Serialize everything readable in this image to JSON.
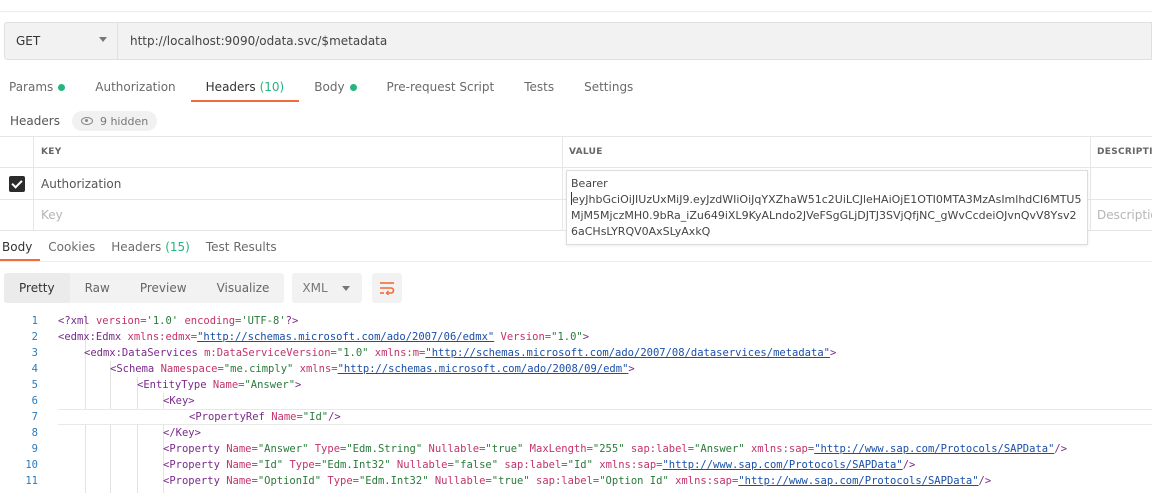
{
  "request": {
    "method": "GET",
    "url": "http://localhost:9090/odata.svc/$metadata"
  },
  "request_tabs": [
    {
      "label": "Params",
      "dot": true,
      "count": ""
    },
    {
      "label": "Authorization",
      "dot": false,
      "count": ""
    },
    {
      "label": "Headers",
      "dot": false,
      "count": "(10)"
    },
    {
      "label": "Body",
      "dot": true,
      "count": ""
    },
    {
      "label": "Pre-request Script",
      "dot": false,
      "count": ""
    },
    {
      "label": "Tests",
      "dot": false,
      "count": ""
    },
    {
      "label": "Settings",
      "dot": false,
      "count": ""
    }
  ],
  "headers_section": {
    "title": "Headers",
    "hidden_label": "9 hidden"
  },
  "table": {
    "col_key": "KEY",
    "col_value": "VALUE",
    "col_description": "DESCRIPTION",
    "row1_key": "Authorization",
    "row1_checked": true,
    "new_key_placeholder": "Key",
    "new_desc_placeholder": "Description"
  },
  "value_popup": {
    "line1": "Bearer",
    "token": "eyJhbGciOiJIUzUxMiJ9.eyJzdWIiOiJqYXZhaW51c2UiLCJleHAiOjE1OTI0MTA3MzAsImlhdCI6MTU5MjM5MjczMH0.9bRa_iZu649iXL9KyALndo2JVeFSgGLjDJTJ3SVjQfjNC_gWvCcdeiOJvnQvV8Ysv26aCHsLYRQV0AxSLyAxkQ"
  },
  "response_tabs": [
    {
      "label": "Body",
      "count": ""
    },
    {
      "label": "Cookies",
      "count": ""
    },
    {
      "label": "Headers",
      "count": "(15)"
    },
    {
      "label": "Test Results",
      "count": ""
    }
  ],
  "response_toolbar": {
    "modes": [
      "Pretty",
      "Raw",
      "Preview",
      "Visualize"
    ],
    "format": "XML"
  },
  "code_lines": [
    "1",
    "2",
    "3",
    "4",
    "5",
    "6",
    "7",
    "8",
    "9",
    "10",
    "11"
  ],
  "code": {
    "l1_a": "<?xml ",
    "l1_b": "version=",
    "l1_c": "'1.0' ",
    "l1_d": "encoding=",
    "l1_e": "'UTF-8'",
    "l1_f": "?>",
    "l2_tag": "<edmx:Edmx ",
    "l2_attr1": "xmlns:edmx=",
    "l2_url1": "\"http://schemas.microsoft.com/ado/2007/06/edmx\"",
    "l2_attr2": " Version=",
    "l2_str2": "\"1.0\"",
    "l2_end": ">",
    "l3_tag": "<edmx:DataServices ",
    "l3_attr1": "m:DataServiceVersion=",
    "l3_str1": "\"1.0\"",
    "l3_attr2": " xmlns:m=",
    "l3_url2": "\"http://schemas.microsoft.com/ado/2007/08/dataservices/metadata\"",
    "l3_end": ">",
    "l4_tag": "<Schema ",
    "l4_attr1": "Namespace=",
    "l4_str1": "\"me.cimply\"",
    "l4_attr2": " xmlns=",
    "l4_url2": "\"http://schemas.microsoft.com/ado/2008/09/edm\"",
    "l4_end": ">",
    "l5_tag": "<EntityType ",
    "l5_attr1": "Name=",
    "l5_str1": "\"Answer\"",
    "l5_end": ">",
    "l6_tag": "<Key>",
    "l7_tag": "<PropertyRef ",
    "l7_attr1": "Name=",
    "l7_str1": "\"Id\"",
    "l7_end": "/>",
    "l8_tag": "</Key>",
    "l9_tag": "<Property ",
    "l9_attr1": "Name=",
    "l9_str1": "\"Answer\"",
    "l9_attr2": " Type=",
    "l9_str2": "\"Edm.String\"",
    "l9_attr3": " Nullable=",
    "l9_str3": "\"true\"",
    "l9_attr4": " MaxLength=",
    "l9_str4": "\"255\"",
    "l9_attr5": " sap:label=",
    "l9_str5": "\"Answer\"",
    "l9_attr6": " xmlns:sap=",
    "l9_url6": "\"http://www.sap.com/Protocols/SAPData\"",
    "l9_end": "/>",
    "l10_tag": "<Property ",
    "l10_attr1": "Name=",
    "l10_str1": "\"Id\"",
    "l10_attr2": " Type=",
    "l10_str2": "\"Edm.Int32\"",
    "l10_attr3": " Nullable=",
    "l10_str3": "\"false\"",
    "l10_attr4": " sap:label=",
    "l10_str4": "\"Id\"",
    "l10_attr5": " xmlns:sap=",
    "l10_url5": "\"http://www.sap.com/Protocols/SAPData\"",
    "l10_end": "/>",
    "l11_tag": "<Property ",
    "l11_attr1": "Name=",
    "l11_str1": "\"OptionId\"",
    "l11_attr2": " Type=",
    "l11_str2": "\"Edm.Int32\"",
    "l11_attr3": " Nullable=",
    "l11_str3": "\"true\"",
    "l11_attr4": " sap:label=",
    "l11_str4": "\"Option Id\"",
    "l11_attr5": " xmlns:sap=",
    "l11_url5": "\"http://www.sap.com/Protocols/SAPData\"",
    "l11_end": "/>"
  },
  "colors": {
    "accent": "#f26b3a",
    "status_green": "#26b47f",
    "line_number": "#2b7bbb"
  }
}
